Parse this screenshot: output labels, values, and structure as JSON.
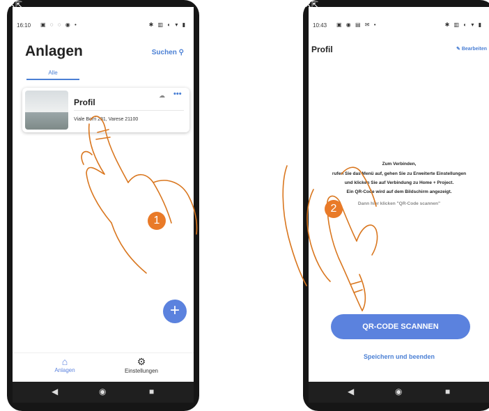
{
  "left": {
    "status": {
      "time": "16:10",
      "icons_left": "▣ ◌ ◌ ◉ •",
      "icons_right": "✱ ▥ ◐ ▾ ▮"
    },
    "title": "Anlagen",
    "search_label": "Suchen",
    "tab_all": "Alle",
    "card": {
      "title": "Profil",
      "address": "Viale Borri 231, Varese 21100",
      "more": "•••"
    },
    "fab": "+",
    "nav": {
      "anlagen": "Anlagen",
      "einstellungen": "Einstellungen"
    }
  },
  "right": {
    "status": {
      "time": "10:43",
      "icons_left": "▣ ◉ ▤ ✉ •",
      "icons_right": "✱ ▥ ◐ ▾ ▮"
    },
    "title": "Profil",
    "edit_label": "Bearbeiten",
    "message": {
      "line1": "Zum Verbinden,",
      "line2": "rufen Sie das Menü auf, gehen Sie zu Erweiterte Einstellungen",
      "line3": "und klicken Sie auf Verbindung zu Home + Project.",
      "line4": "Ein QR-Code wird auf dem Bildschirm angezeigt.",
      "line5": "Dann hier klicken \"QR-Code scannen\""
    },
    "scan_button": "QR-CODE SCANNEN",
    "save_link": "Speichern und beenden"
  },
  "badges": {
    "one": "1",
    "two": "2"
  },
  "colors": {
    "accent": "#5b82de",
    "badge": "#e97a28"
  }
}
